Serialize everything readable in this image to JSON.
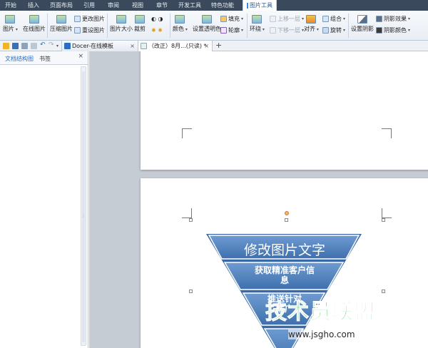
{
  "ribbon_tabs": [
    "开始",
    "插入",
    "页面布局",
    "引用",
    "审阅",
    "视图",
    "章节",
    "开发工具",
    "特色功能",
    "图片工具"
  ],
  "ribbon": {
    "picture": "图片",
    "online_picture": "在线图片",
    "compress": "压缩图片",
    "change_picture": "更改图片",
    "reset_picture": "重设图片",
    "picture_size": "图片大小",
    "crop": "裁剪",
    "color": "颜色",
    "set_transparent": "设置透明色",
    "fill": "填充",
    "outline": "轮廓",
    "wrap": "环绕",
    "bring_forward": "上移一层",
    "send_backward": "下移一层",
    "align": "对齐",
    "group": "组合",
    "rotate": "旋转",
    "shadow_settings": "设置阴影",
    "shadow_effect": "阴影效果",
    "shadow_color": "阴影颜色"
  },
  "doc_tabs": {
    "docer": "Docer-在线模板",
    "current": "（改正）8月...(只读) *"
  },
  "left_panel": {
    "tab_outline": "文档结构图",
    "tab_bookmark": "书签"
  },
  "funnel": {
    "level1": "修改图片文字",
    "level2_line1": "获取精准客户信",
    "level2_line2": "息",
    "level3_line1": "推送针对",
    "level3_line2": "性广"
  },
  "watermark": {
    "brand": "技术员联盟",
    "url": "www.jsgho.com"
  },
  "colors": {
    "funnel_fill": "#4f81bd",
    "funnel_edge": "#3a6aa5",
    "accent": "#2c6fc0"
  }
}
